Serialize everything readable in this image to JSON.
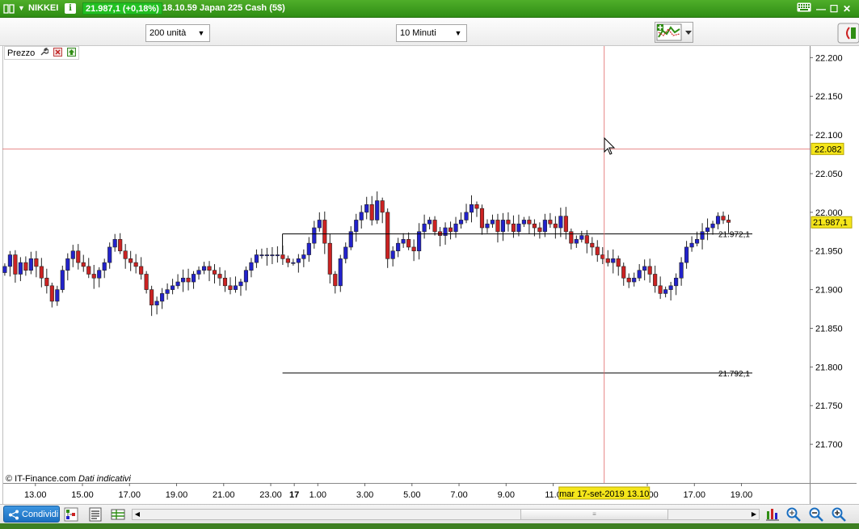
{
  "titlebar": {
    "instrument": "NIKKEI",
    "info_label": "i",
    "price_badge": "21.987,1 (+0,18%)",
    "time": "18.10.59",
    "name": "Japan 225 Cash (5$)",
    "minimize": "—",
    "maximize": "☐",
    "close": "✕"
  },
  "toolbar": {
    "units_select": "200 unità",
    "timeframe_select": "10 Minuti"
  },
  "panel": {
    "title": "Prezzo"
  },
  "footer_note": {
    "copyright": "© IT-Finance.com",
    "delayed": "Dati indicativi"
  },
  "bottombar": {
    "share_label": "Condividi",
    "scroll_grip": "≡"
  },
  "colors": {
    "brand_green": "#2f8d14",
    "up_candle": "#2222cc",
    "down_candle": "#cc2222",
    "price_label": "#f5e61a",
    "crosshair": "#e06666"
  },
  "chart_data": {
    "type": "candlestick",
    "y_axis": {
      "range": [
        21650,
        22215
      ],
      "ticks": [
        "22.200",
        "22.150",
        "22.100",
        "22.050",
        "22.000",
        "21.950",
        "21.900",
        "21.850",
        "21.800",
        "21.750",
        "21.700"
      ],
      "tick_values": [
        22200,
        22150,
        22100,
        22050,
        22000,
        21950,
        21900,
        21850,
        21800,
        21750,
        21700
      ]
    },
    "x_axis": {
      "ticks": [
        "13.00",
        "15.00",
        "17.00",
        "19.00",
        "21.00",
        "23.00",
        "17",
        "1.00",
        "3.00",
        "5.00",
        "7.00",
        "9.00",
        "11.0",
        "15.00",
        "17.00",
        "19.00"
      ],
      "tick_times": [
        13,
        15,
        17,
        19,
        21,
        23,
        24,
        25,
        27,
        29,
        31,
        33,
        35,
        39,
        41,
        43
      ],
      "range_hours": [
        11.6,
        45.9
      ]
    },
    "crosshair": {
      "price_label": "22.082",
      "price": 22082,
      "time_label": "mar 17-set-2019 13.10",
      "time": 37.17
    },
    "last_price": {
      "label": "21.987,1",
      "value": 21987.1
    },
    "levels": [
      {
        "label": "21.972,1",
        "value": 21972.1,
        "from_time": 23.5
      },
      {
        "label": "21.792,1",
        "value": 21792.1,
        "from_time": 23.5
      }
    ],
    "series_close": [
      21930,
      21945,
      21920,
      21935,
      21925,
      21940,
      21930,
      21915,
      21905,
      21885,
      21900,
      21925,
      21940,
      21950,
      21935,
      21930,
      21920,
      21915,
      21925,
      21935,
      21955,
      21965,
      21950,
      21940,
      21935,
      21930,
      21920,
      21900,
      21880,
      21885,
      21895,
      21900,
      21905,
      21910,
      21915,
      21910,
      21920,
      21925,
      21930,
      21925,
      21920,
      21915,
      21905,
      21900,
      21905,
      21910,
      21925,
      21935,
      21945,
      21945,
      21945,
      21945,
      21945,
      21940,
      21935,
      21935,
      21940,
      21945,
      21960,
      21980,
      21990,
      21960,
      21920,
      21905,
      21940,
      21955,
      21975,
      21990,
      22000,
      22010,
      21990,
      22015,
      22000,
      21940,
      21950,
      21960,
      21965,
      21955,
      21950,
      21975,
      21985,
      21990,
      21975,
      21970,
      21980,
      21975,
      21985,
      21990,
      22000,
      22010,
      22005,
      21980,
      21985,
      21990,
      21975,
      21990,
      21985,
      21975,
      21985,
      21990,
      21985,
      21980,
      21975,
      21990,
      21985,
      21980,
      21995,
      21975,
      21960,
      21965,
      21970,
      21960,
      21955,
      21945,
      21940,
      21935,
      21940,
      21930,
      21915,
      21910,
      21915,
      21925,
      21930,
      21920,
      21905,
      21895,
      21900,
      21905,
      21915,
      21935,
      21955,
      21960,
      21965,
      21975,
      21980,
      21985,
      21995,
      21990,
      21987
    ]
  }
}
